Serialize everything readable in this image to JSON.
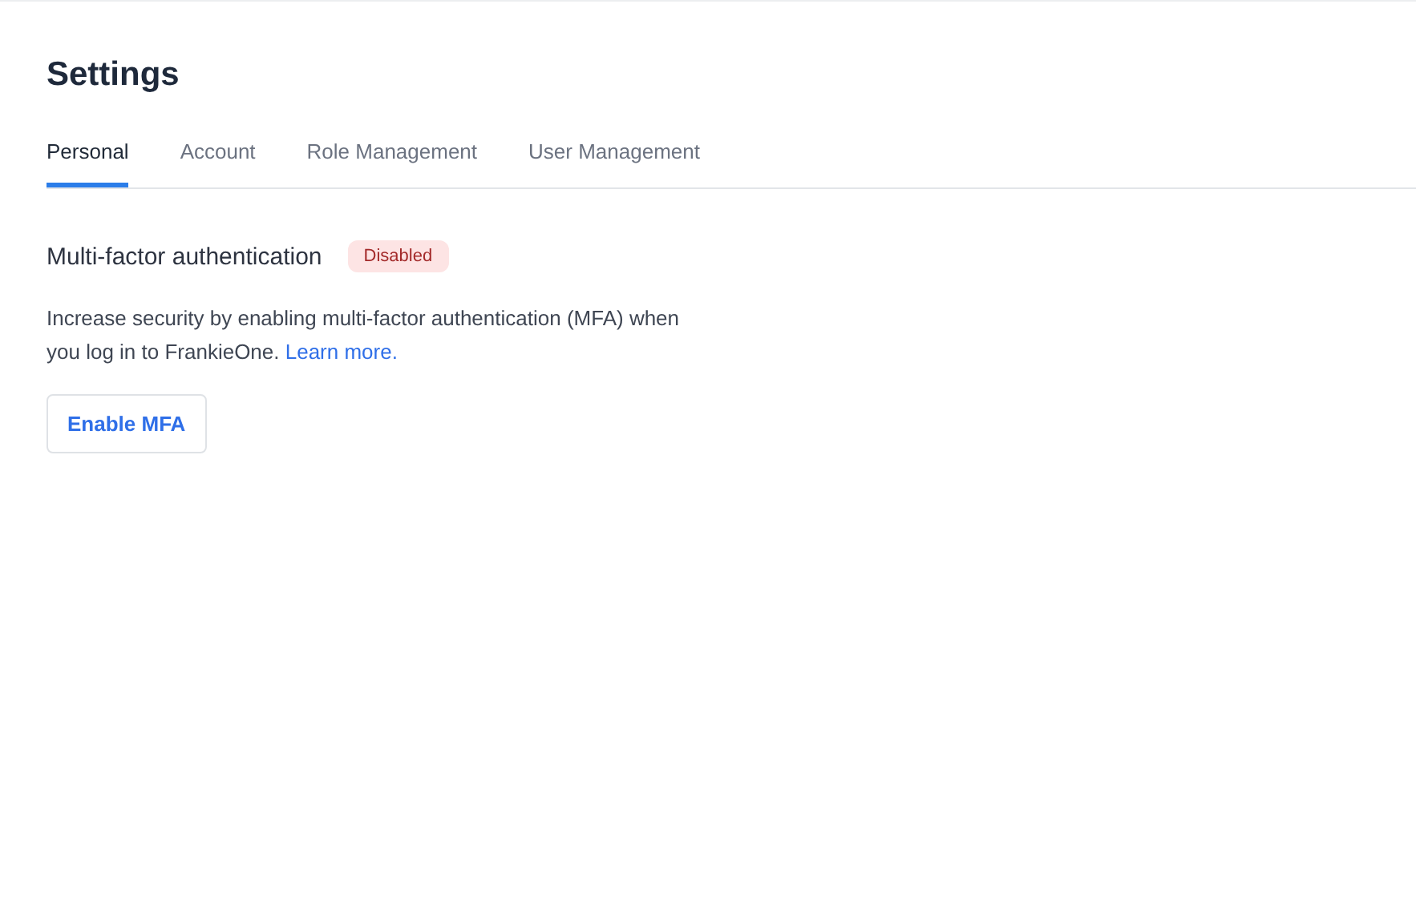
{
  "page": {
    "title": "Settings"
  },
  "tabs": [
    {
      "label": "Personal",
      "selected": true
    },
    {
      "label": "Account",
      "selected": false
    },
    {
      "label": "Role Management",
      "selected": false
    },
    {
      "label": "User Management",
      "selected": false
    }
  ],
  "mfa": {
    "title": "Multi-factor authentication",
    "status": {
      "label": "Disabled",
      "kind": "disabled"
    },
    "description": "Increase security by enabling multi-factor authentication (MFA) when you log in to FrankieOne.",
    "link": "Learn more.",
    "button": "Enable MFA"
  }
}
